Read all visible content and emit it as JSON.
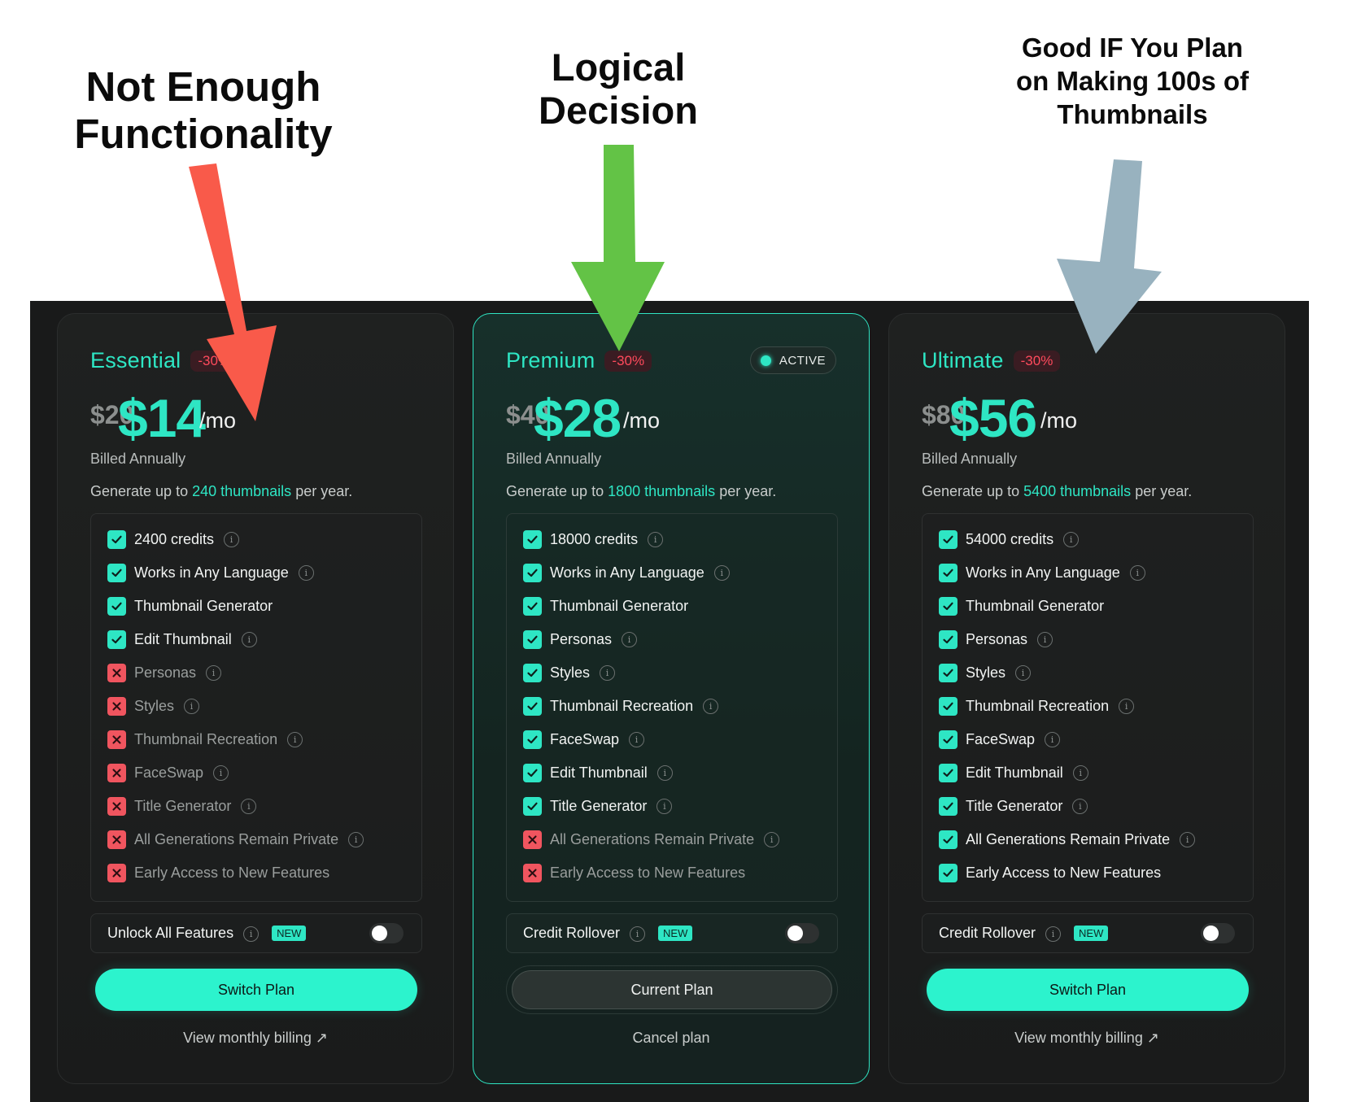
{
  "annotations": {
    "left": "Not Enough\nFunctionality",
    "middle": "Logical\nDecision",
    "right": "Good IF You Plan\non Making 100s of\nThumbnails",
    "colors": {
      "left_arrow": "#f95a4a",
      "middle_arrow": "#63c346",
      "right_arrow": "#98b2bf"
    }
  },
  "plans": [
    {
      "name": "Essential",
      "discount": "-30%",
      "old_price": "$20",
      "price": "$14",
      "per": "/mo",
      "billed": "Billed Annually",
      "generate_prefix": "Generate up to ",
      "generate_highlight": "240 thumbnails",
      "generate_suffix": " per year.",
      "features": [
        {
          "label": "2400 credits",
          "included": true,
          "info": true
        },
        {
          "label": "Works in Any Language",
          "included": true,
          "info": true
        },
        {
          "label": "Thumbnail Generator",
          "included": true,
          "info": false
        },
        {
          "label": "Edit Thumbnail",
          "included": true,
          "info": true
        },
        {
          "label": "Personas",
          "included": false,
          "info": true
        },
        {
          "label": "Styles",
          "included": false,
          "info": true
        },
        {
          "label": "Thumbnail Recreation",
          "included": false,
          "info": true
        },
        {
          "label": "FaceSwap",
          "included": false,
          "info": true
        },
        {
          "label": "Title Generator",
          "included": false,
          "info": true
        },
        {
          "label": "All Generations Remain Private",
          "included": false,
          "info": true
        },
        {
          "label": "Early Access to New Features",
          "included": false,
          "info": false
        }
      ],
      "addon_label": "Unlock All Features",
      "addon_badge": "NEW",
      "button_label": "Switch Plan",
      "bottom_link": "View monthly billing ↗"
    },
    {
      "name": "Premium",
      "discount": "-30%",
      "status": "ACTIVE",
      "old_price": "$40",
      "price": "$28",
      "per": "/mo",
      "billed": "Billed Annually",
      "generate_prefix": "Generate up to ",
      "generate_highlight": "1800 thumbnails",
      "generate_suffix": " per year.",
      "features": [
        {
          "label": "18000 credits",
          "included": true,
          "info": true
        },
        {
          "label": "Works in Any Language",
          "included": true,
          "info": true
        },
        {
          "label": "Thumbnail Generator",
          "included": true,
          "info": false
        },
        {
          "label": "Personas",
          "included": true,
          "info": true
        },
        {
          "label": "Styles",
          "included": true,
          "info": true
        },
        {
          "label": "Thumbnail Recreation",
          "included": true,
          "info": true
        },
        {
          "label": "FaceSwap",
          "included": true,
          "info": true
        },
        {
          "label": "Edit Thumbnail",
          "included": true,
          "info": true
        },
        {
          "label": "Title Generator",
          "included": true,
          "info": true
        },
        {
          "label": "All Generations Remain Private",
          "included": false,
          "info": true
        },
        {
          "label": "Early Access to New Features",
          "included": false,
          "info": false
        }
      ],
      "addon_label": "Credit Rollover",
      "addon_badge": "NEW",
      "button_label": "Current Plan",
      "bottom_link": "Cancel plan"
    },
    {
      "name": "Ultimate",
      "discount": "-30%",
      "old_price": "$80",
      "price": "$56",
      "per": "/mo",
      "billed": "Billed Annually",
      "generate_prefix": "Generate up to ",
      "generate_highlight": "5400 thumbnails",
      "generate_suffix": " per year.",
      "features": [
        {
          "label": "54000 credits",
          "included": true,
          "info": true
        },
        {
          "label": "Works in Any Language",
          "included": true,
          "info": true
        },
        {
          "label": "Thumbnail Generator",
          "included": true,
          "info": false
        },
        {
          "label": "Personas",
          "included": true,
          "info": true
        },
        {
          "label": "Styles",
          "included": true,
          "info": true
        },
        {
          "label": "Thumbnail Recreation",
          "included": true,
          "info": true
        },
        {
          "label": "FaceSwap",
          "included": true,
          "info": true
        },
        {
          "label": "Edit Thumbnail",
          "included": true,
          "info": true
        },
        {
          "label": "Title Generator",
          "included": true,
          "info": true
        },
        {
          "label": "All Generations Remain Private",
          "included": true,
          "info": true
        },
        {
          "label": "Early Access to New Features",
          "included": true,
          "info": false
        }
      ],
      "addon_label": "Credit Rollover",
      "addon_badge": "NEW",
      "button_label": "Switch Plan",
      "bottom_link": "View monthly billing ↗"
    }
  ],
  "icons": {
    "check": "check-icon",
    "cross": "cross-icon",
    "info": "info-icon",
    "external": "external-link-icon"
  },
  "accent_color": "#2ee6c4"
}
